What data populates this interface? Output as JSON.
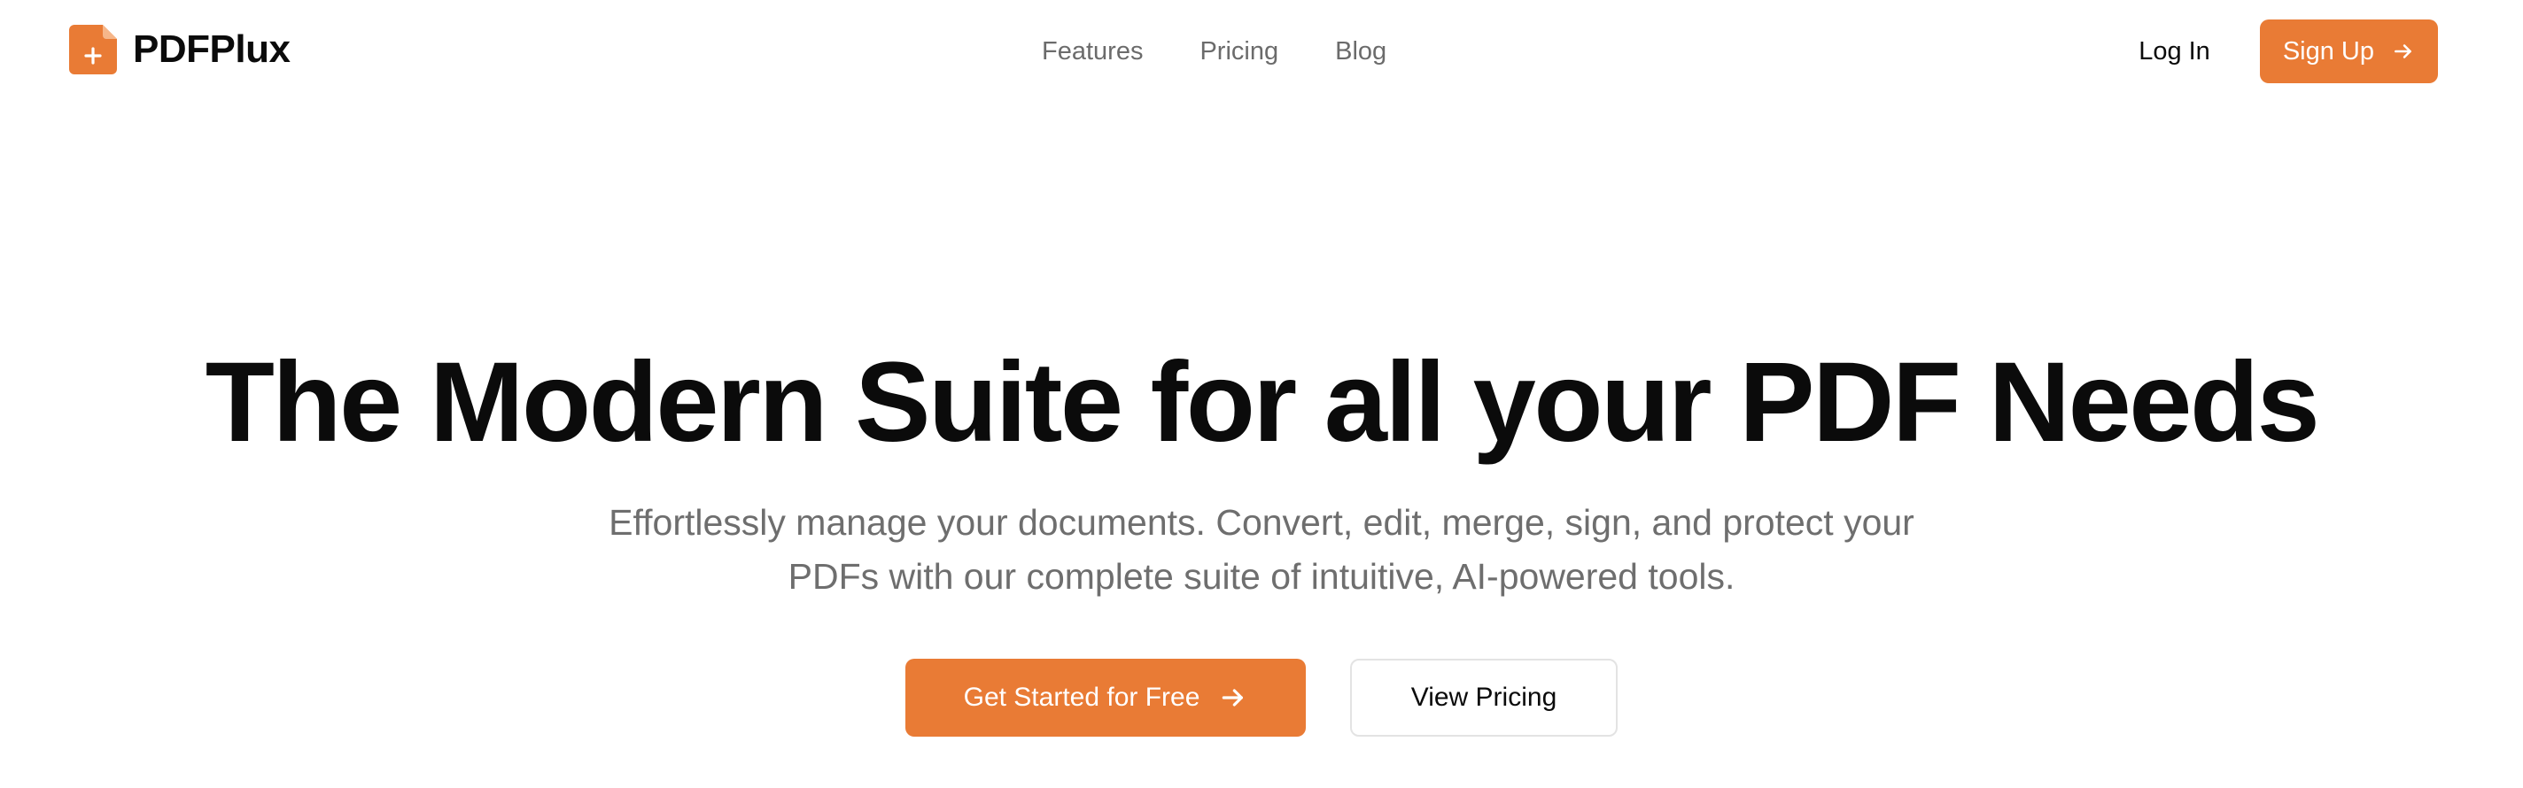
{
  "brand": {
    "name": "PDFPlux",
    "icon": "pdf-plus-icon",
    "accent_color": "#e97b35"
  },
  "nav": {
    "items": [
      {
        "label": "Features"
      },
      {
        "label": "Pricing"
      },
      {
        "label": "Blog"
      }
    ]
  },
  "header": {
    "login_label": "Log In",
    "signup_label": "Sign Up",
    "signup_icon": "arrow-right-icon"
  },
  "hero": {
    "title": "The Modern Suite for all your PDF Needs",
    "subtitle": "Effortlessly manage your documents. Convert, edit, merge, sign, and protect your PDFs with our complete suite of intuitive, AI-powered tools.",
    "primary_cta": "Get Started for Free",
    "primary_cta_icon": "arrow-right-icon",
    "secondary_cta": "View Pricing"
  }
}
